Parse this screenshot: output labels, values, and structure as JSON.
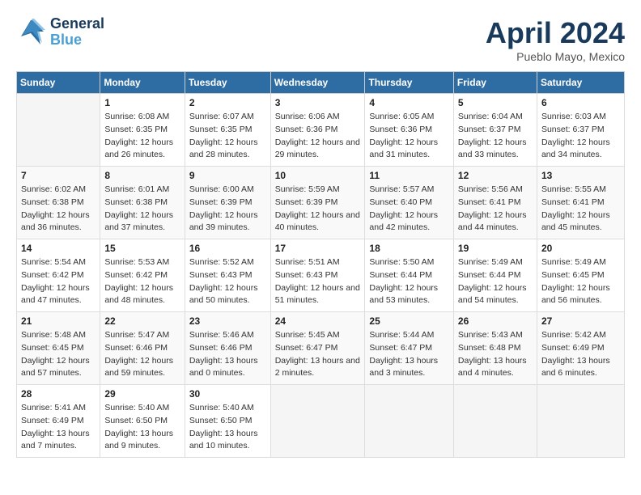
{
  "header": {
    "logo_line1": "General",
    "logo_line2": "Blue",
    "month_title": "April 2024",
    "location": "Pueblo Mayo, Mexico"
  },
  "weekdays": [
    "Sunday",
    "Monday",
    "Tuesday",
    "Wednesday",
    "Thursday",
    "Friday",
    "Saturday"
  ],
  "weeks": [
    [
      {
        "day": "",
        "empty": true
      },
      {
        "day": "1",
        "sunrise": "6:08 AM",
        "sunset": "6:35 PM",
        "daylight": "12 hours and 26 minutes."
      },
      {
        "day": "2",
        "sunrise": "6:07 AM",
        "sunset": "6:35 PM",
        "daylight": "12 hours and 28 minutes."
      },
      {
        "day": "3",
        "sunrise": "6:06 AM",
        "sunset": "6:36 PM",
        "daylight": "12 hours and 29 minutes."
      },
      {
        "day": "4",
        "sunrise": "6:05 AM",
        "sunset": "6:36 PM",
        "daylight": "12 hours and 31 minutes."
      },
      {
        "day": "5",
        "sunrise": "6:04 AM",
        "sunset": "6:37 PM",
        "daylight": "12 hours and 33 minutes."
      },
      {
        "day": "6",
        "sunrise": "6:03 AM",
        "sunset": "6:37 PM",
        "daylight": "12 hours and 34 minutes."
      }
    ],
    [
      {
        "day": "7",
        "sunrise": "6:02 AM",
        "sunset": "6:38 PM",
        "daylight": "12 hours and 36 minutes."
      },
      {
        "day": "8",
        "sunrise": "6:01 AM",
        "sunset": "6:38 PM",
        "daylight": "12 hours and 37 minutes."
      },
      {
        "day": "9",
        "sunrise": "6:00 AM",
        "sunset": "6:39 PM",
        "daylight": "12 hours and 39 minutes."
      },
      {
        "day": "10",
        "sunrise": "5:59 AM",
        "sunset": "6:39 PM",
        "daylight": "12 hours and 40 minutes."
      },
      {
        "day": "11",
        "sunrise": "5:57 AM",
        "sunset": "6:40 PM",
        "daylight": "12 hours and 42 minutes."
      },
      {
        "day": "12",
        "sunrise": "5:56 AM",
        "sunset": "6:41 PM",
        "daylight": "12 hours and 44 minutes."
      },
      {
        "day": "13",
        "sunrise": "5:55 AM",
        "sunset": "6:41 PM",
        "daylight": "12 hours and 45 minutes."
      }
    ],
    [
      {
        "day": "14",
        "sunrise": "5:54 AM",
        "sunset": "6:42 PM",
        "daylight": "12 hours and 47 minutes."
      },
      {
        "day": "15",
        "sunrise": "5:53 AM",
        "sunset": "6:42 PM",
        "daylight": "12 hours and 48 minutes."
      },
      {
        "day": "16",
        "sunrise": "5:52 AM",
        "sunset": "6:43 PM",
        "daylight": "12 hours and 50 minutes."
      },
      {
        "day": "17",
        "sunrise": "5:51 AM",
        "sunset": "6:43 PM",
        "daylight": "12 hours and 51 minutes."
      },
      {
        "day": "18",
        "sunrise": "5:50 AM",
        "sunset": "6:44 PM",
        "daylight": "12 hours and 53 minutes."
      },
      {
        "day": "19",
        "sunrise": "5:49 AM",
        "sunset": "6:44 PM",
        "daylight": "12 hours and 54 minutes."
      },
      {
        "day": "20",
        "sunrise": "5:49 AM",
        "sunset": "6:45 PM",
        "daylight": "12 hours and 56 minutes."
      }
    ],
    [
      {
        "day": "21",
        "sunrise": "5:48 AM",
        "sunset": "6:45 PM",
        "daylight": "12 hours and 57 minutes."
      },
      {
        "day": "22",
        "sunrise": "5:47 AM",
        "sunset": "6:46 PM",
        "daylight": "12 hours and 59 minutes."
      },
      {
        "day": "23",
        "sunrise": "5:46 AM",
        "sunset": "6:46 PM",
        "daylight": "13 hours and 0 minutes."
      },
      {
        "day": "24",
        "sunrise": "5:45 AM",
        "sunset": "6:47 PM",
        "daylight": "13 hours and 2 minutes."
      },
      {
        "day": "25",
        "sunrise": "5:44 AM",
        "sunset": "6:47 PM",
        "daylight": "13 hours and 3 minutes."
      },
      {
        "day": "26",
        "sunrise": "5:43 AM",
        "sunset": "6:48 PM",
        "daylight": "13 hours and 4 minutes."
      },
      {
        "day": "27",
        "sunrise": "5:42 AM",
        "sunset": "6:49 PM",
        "daylight": "13 hours and 6 minutes."
      }
    ],
    [
      {
        "day": "28",
        "sunrise": "5:41 AM",
        "sunset": "6:49 PM",
        "daylight": "13 hours and 7 minutes."
      },
      {
        "day": "29",
        "sunrise": "5:40 AM",
        "sunset": "6:50 PM",
        "daylight": "13 hours and 9 minutes."
      },
      {
        "day": "30",
        "sunrise": "5:40 AM",
        "sunset": "6:50 PM",
        "daylight": "13 hours and 10 minutes."
      },
      {
        "day": "",
        "empty": true
      },
      {
        "day": "",
        "empty": true
      },
      {
        "day": "",
        "empty": true
      },
      {
        "day": "",
        "empty": true
      }
    ]
  ]
}
